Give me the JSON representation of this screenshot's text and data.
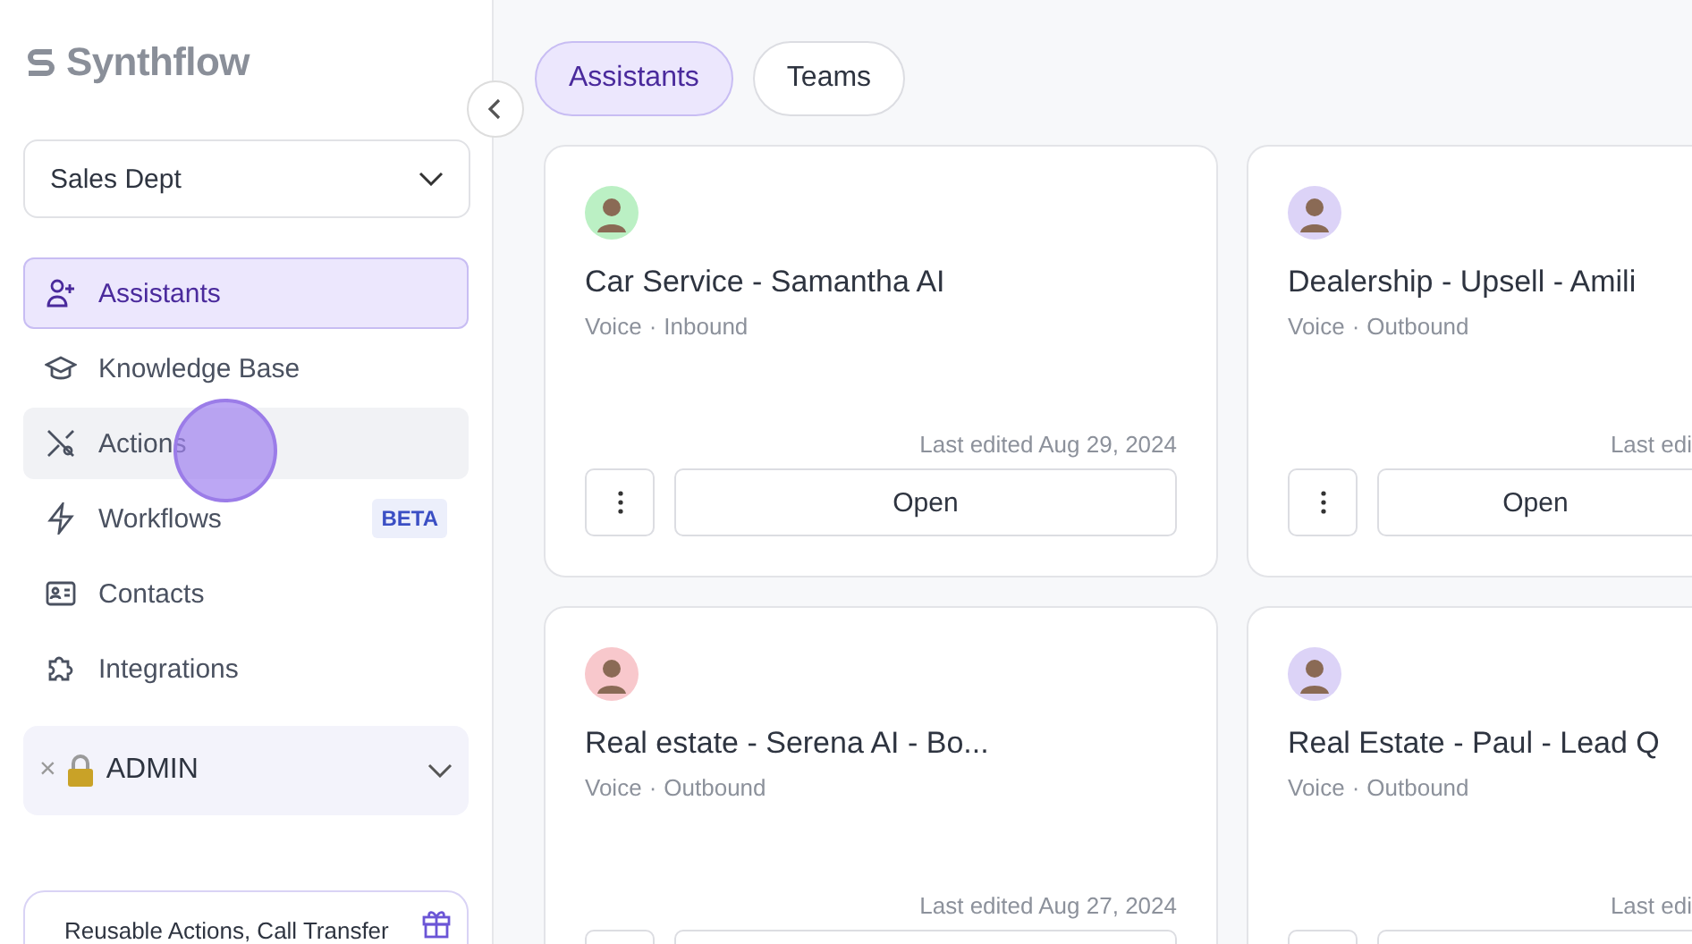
{
  "logo": {
    "text": "Synthflow"
  },
  "workspace": {
    "value": "Sales Dept"
  },
  "nav": [
    {
      "label": "Assistants",
      "selected": true,
      "hovered": false
    },
    {
      "label": "Knowledge Base",
      "selected": false,
      "hovered": false
    },
    {
      "label": "Actions",
      "selected": false,
      "hovered": true
    },
    {
      "label": "Workflows",
      "selected": false,
      "hovered": false,
      "badge": "BETA"
    },
    {
      "label": "Contacts",
      "selected": false,
      "hovered": false
    },
    {
      "label": "Integrations",
      "selected": false,
      "hovered": false
    }
  ],
  "admin": {
    "close": "×",
    "label": "ADMIN"
  },
  "promo": {
    "text": "Reusable Actions, Call Transfer"
  },
  "tabs": [
    {
      "label": "Assistants",
      "selected": true
    },
    {
      "label": "Teams",
      "selected": false
    }
  ],
  "cards": [
    {
      "title": "Car Service - Samantha AI",
      "channel": "Voice",
      "separator": "·",
      "direction": "Inbound",
      "edited": "Last edited Aug 29, 2024",
      "open": "Open",
      "color": "#bbf0c4"
    },
    {
      "title": "Dealership - Upsell - Amili",
      "channel": "Voice",
      "separator": "·",
      "direction": "Outbound",
      "edited": "Last edi",
      "open": "Open",
      "color": "#dcd3f7"
    },
    {
      "title": "Real estate - Serena AI - Bo...",
      "channel": "Voice",
      "separator": "·",
      "direction": "Outbound",
      "edited": "Last edited Aug 27, 2024",
      "color": "#f8c8cc"
    },
    {
      "title": "Real Estate - Paul - Lead Q",
      "channel": "Voice",
      "separator": "·",
      "direction": "Outbound",
      "edited": "Last edi",
      "color": "#dcd3f7"
    }
  ]
}
